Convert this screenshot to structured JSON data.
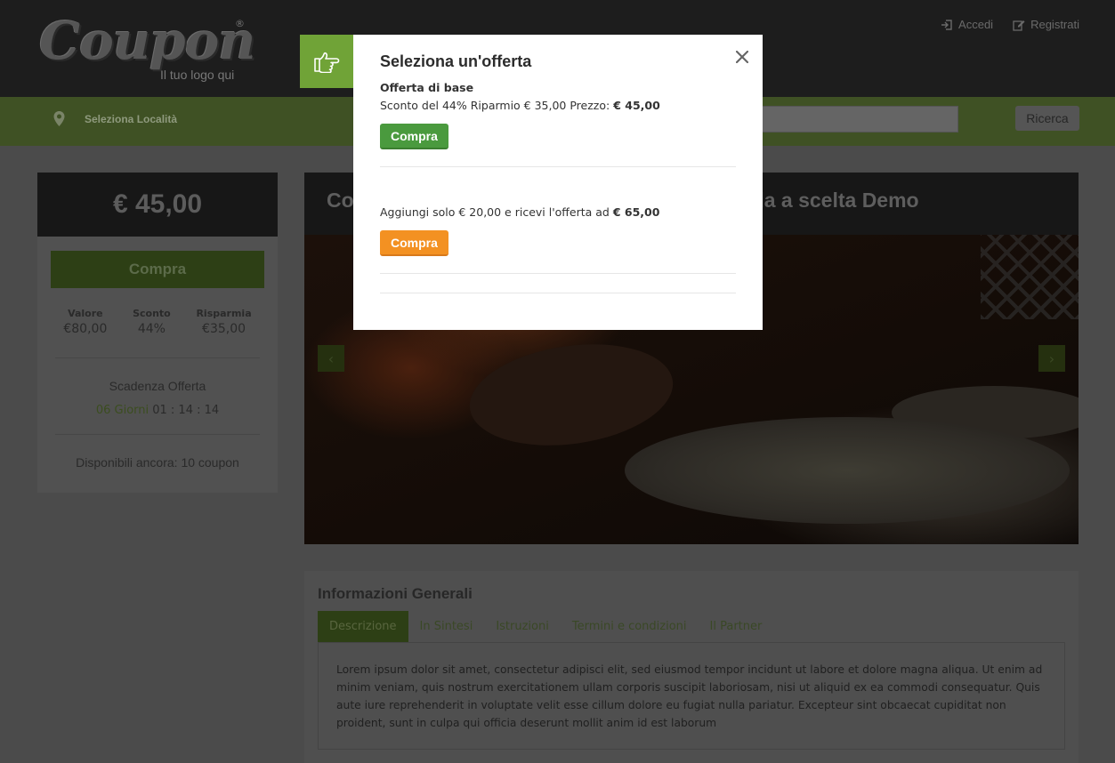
{
  "header": {
    "logo_word": "Coupon",
    "logo_reg": "®",
    "logo_tagline": "Il tuo logo qui",
    "login_label": "Accedi",
    "register_label": "Registrati"
  },
  "nav": {
    "location_label": "Seleziona Località",
    "search_button": "Ricerca"
  },
  "sidebar": {
    "price": "€ 45,00",
    "buy_label": "Compra",
    "stats": [
      {
        "label": "Valore",
        "value": "€80,00"
      },
      {
        "label": "Sconto",
        "value": "44%"
      },
      {
        "label": "Risparmia",
        "value": "€35,00"
      }
    ],
    "expiry_title": "Scadenza Offerta",
    "countdown_days": "06 Giorni",
    "countdown_time": "01 : 14 : 14",
    "available": "Disponibili ancora: 10 coupon"
  },
  "deal": {
    "title_start": "Co",
    "title_end": "da a scelta Demo"
  },
  "info": {
    "title": "Informazioni Generali",
    "tabs": [
      "Descrizione",
      "In Sintesi",
      "Istruzioni",
      "Termini e condizioni",
      "Il Partner"
    ],
    "description": "Lorem ipsum dolor sit amet, consectetur adipisci elit, sed eiusmod tempor incidunt ut labore et dolore magna aliqua. Ut enim ad minim veniam, quis nostrum exercitationem ullam corporis suscipit laboriosam, nisi ut aliquid ex ea commodi consequatur. Quis aute iure reprehenderit in voluptate velit esse cillum dolore eu fugiat nulla pariatur. Excepteur sint obcaecat cupiditat non proident, sunt in culpa qui officia deserunt mollit anim id est laborum"
  },
  "modal": {
    "title": "Seleziona un'offerta",
    "base_offer_heading": "Offerta di base",
    "base_offer_text": "Sconto del 44% Riparmio € 35,00 Prezzo:",
    "base_offer_price": "€ 45,00",
    "base_offer_button": "Compra",
    "upgrade_text": "Aggiungi solo € 20,00 e ricevi l'offerta ad",
    "upgrade_price": "€ 65,00",
    "upgrade_button": "Compra"
  },
  "colors": {
    "modal_badge": "#70a337",
    "buy_green": "#4a9a3e",
    "buy_orange": "#f39122"
  },
  "icons": {
    "badge": "thumbs-pointing-hand-icon",
    "close": "close-icon",
    "login": "sign-in-icon",
    "register": "edit-icon",
    "location": "map-pin-icon"
  }
}
